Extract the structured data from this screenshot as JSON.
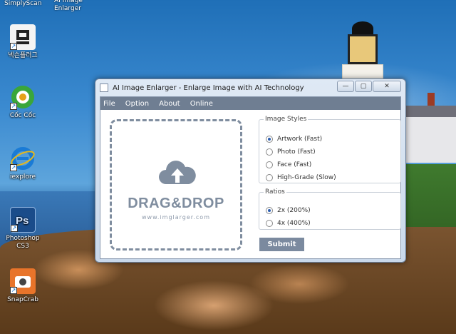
{
  "desktop": {
    "cut_labels": [
      "SimplyScan",
      "AI Image\nEnlarger"
    ],
    "icons": [
      {
        "label": "넥슨플러그",
        "icon": "nexon-plug-icon",
        "color": "#f4f4f4"
      },
      {
        "label": "Cốc Cốc",
        "icon": "coccoc-icon",
        "color": "#2e8b2e"
      },
      {
        "label": "iexplore",
        "icon": "internet-explorer-icon",
        "color": "#1a7bd6"
      },
      {
        "label": "Photoshop CS3",
        "icon": "photoshop-icon",
        "color": "#1a4c8a"
      },
      {
        "label": "SnapCrab",
        "icon": "snapcrab-icon",
        "color": "#e8742a"
      }
    ]
  },
  "window": {
    "title": "AI Image Enlarger - Enlarge Image with AI Technology",
    "controls": {
      "minimize": "—",
      "maximize": "▢",
      "close": "✕"
    },
    "menu": [
      "File",
      "Option",
      "About",
      "Online"
    ],
    "dropzone": {
      "title": "DRAG&DROP",
      "url": "www.imglarger.com"
    },
    "image_styles": {
      "legend": "Image Styles",
      "options": [
        "Artwork (Fast)",
        "Photo (Fast)",
        "Face (Fast)",
        "High-Grade (Slow)"
      ],
      "selected": 0
    },
    "ratios": {
      "legend": "Ratios",
      "options": [
        "2x (200%)",
        "4x (400%)"
      ],
      "selected": 0
    },
    "submit_label": "Submit"
  }
}
